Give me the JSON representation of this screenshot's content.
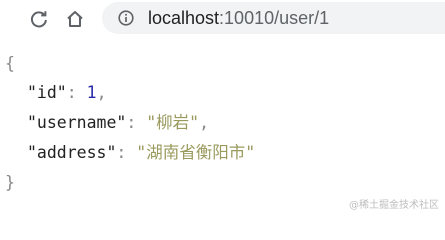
{
  "browser": {
    "url_host": "localhost",
    "url_rest": ":10010/user/1"
  },
  "json_view": {
    "open_brace": "{",
    "close_brace": "}",
    "fields": [
      {
        "key": "\"id\"",
        "sep": ": ",
        "value": "1",
        "trail": ","
      },
      {
        "key": "\"username\"",
        "sep": ": ",
        "value": "\"柳岩\"",
        "trail": ","
      },
      {
        "key": "\"address\"",
        "sep": ": ",
        "value": "\"湖南省衡阳市\"",
        "trail": ""
      }
    ]
  },
  "watermark": "@稀土掘金技术社区"
}
